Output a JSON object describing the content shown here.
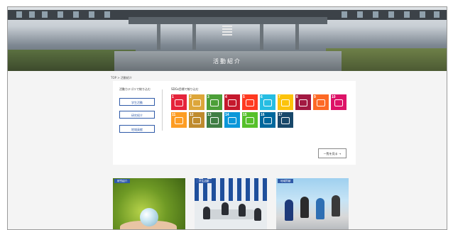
{
  "hero": {
    "title": "活動紹介"
  },
  "breadcrumb": {
    "text": "TOP > 活動紹介"
  },
  "left_column": {
    "title": "活動カテゴリで絞り込む",
    "buttons": [
      {
        "label": "学生活動"
      },
      {
        "label": "研究紹介"
      },
      {
        "label": "地域貢献"
      }
    ]
  },
  "sdgs": {
    "title": "SDGs目標で絞り込む",
    "goals": [
      {
        "num": "1",
        "color": "#e5243b"
      },
      {
        "num": "2",
        "color": "#dda63a"
      },
      {
        "num": "3",
        "color": "#4c9f38"
      },
      {
        "num": "4",
        "color": "#c5192d"
      },
      {
        "num": "5",
        "color": "#ff3a21"
      },
      {
        "num": "6",
        "color": "#26bde2"
      },
      {
        "num": "7",
        "color": "#fcc30b"
      },
      {
        "num": "8",
        "color": "#a21942"
      },
      {
        "num": "9",
        "color": "#fd6925"
      },
      {
        "num": "10",
        "color": "#dd1367"
      },
      {
        "num": "11",
        "color": "#fd9d24"
      },
      {
        "num": "12",
        "color": "#bf8b2e"
      },
      {
        "num": "13",
        "color": "#3f7e44"
      },
      {
        "num": "14",
        "color": "#0a97d9"
      },
      {
        "num": "15",
        "color": "#56c02b"
      },
      {
        "num": "16",
        "color": "#00689d"
      },
      {
        "num": "17",
        "color": "#19486a"
      }
    ]
  },
  "list_button": {
    "label": "一覧を見る →"
  },
  "thumbnails": [
    {
      "badge": "研究紹介"
    },
    {
      "badge": "学生活動"
    },
    {
      "badge": "地域貢献"
    }
  ]
}
